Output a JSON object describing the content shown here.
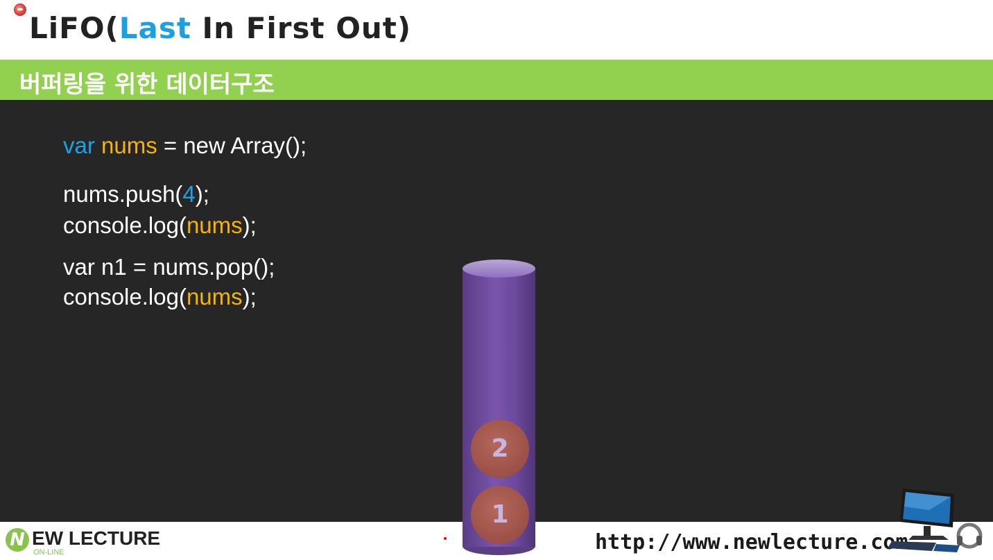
{
  "header": {
    "title_prefix": "LiFO(",
    "title_accent": "Last",
    "title_suffix": " In First Out)",
    "subtitle": "버퍼링을 위한 데이터구조"
  },
  "code": {
    "line1": {
      "kw": "var",
      "var": "nums",
      "rest": " = new Array();"
    },
    "line2": {
      "text": "nums.push(",
      "num": "4",
      "end": ");"
    },
    "line3": {
      "text": "console.log(",
      "var": "nums",
      "end": ");"
    },
    "line4": {
      "text": "var n1 = nums.pop();"
    },
    "line5": {
      "text": "console.log(",
      "var": "nums",
      "end": ");"
    }
  },
  "stack": {
    "items": [
      "2",
      "1"
    ]
  },
  "footer": {
    "logo_letter": "N",
    "logo_text": "EW LECTURE",
    "logo_sub": "ON-LINE",
    "url": "http://www.newlecture.com"
  },
  "colors": {
    "accent_blue": "#1ba1e2",
    "highlight_yellow": "#f5b400",
    "subheader_green": "#92d050",
    "slide_bg": "#262626",
    "stack_purple": "#7b55ad",
    "item_red": "#9b5048"
  },
  "icons": [
    "record-indicator-icon",
    "computer-desktop-icon"
  ]
}
